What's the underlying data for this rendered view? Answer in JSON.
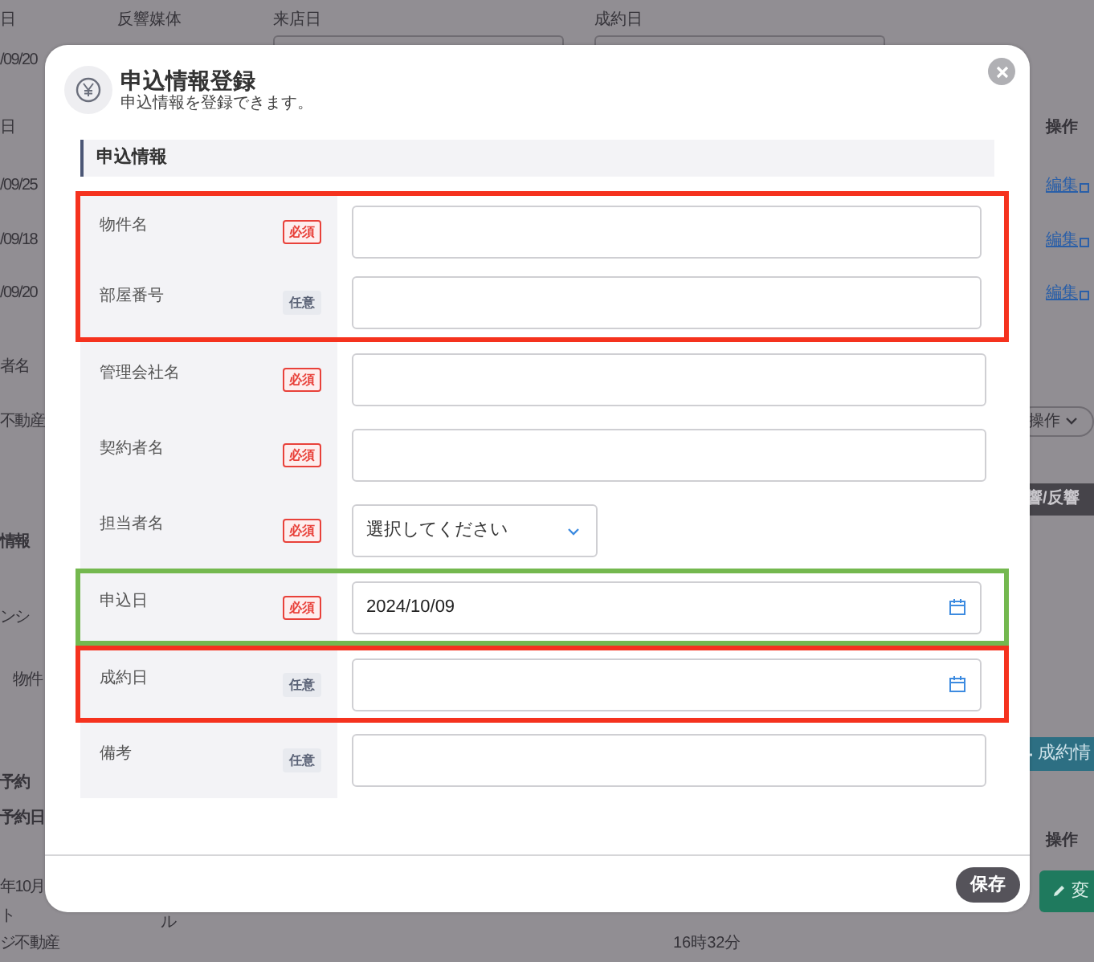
{
  "background": {
    "top_labels": [
      {
        "text": "日",
        "kind": "label"
      },
      {
        "text": "反響媒体",
        "kind": "label"
      },
      {
        "text": "来店日",
        "kind": "field-label"
      },
      {
        "text": "成約日",
        "kind": "field-label"
      }
    ],
    "left_column": [
      {
        "text": "/09/20",
        "kind": "text"
      },
      {
        "text": "日",
        "kind": "text"
      },
      {
        "text": "/09/25",
        "kind": "text"
      },
      {
        "text": "/09/18",
        "kind": "text"
      },
      {
        "text": "/09/20",
        "kind": "text"
      },
      {
        "text": "者名",
        "kind": "text"
      },
      {
        "text": "不動産",
        "kind": "text"
      },
      {
        "text": "情報",
        "kind": "heading"
      },
      {
        "text": "ンシ",
        "kind": "text"
      },
      {
        "text": "物件",
        "kind": "text"
      },
      {
        "text": "予約",
        "kind": "heading"
      },
      {
        "text": "予約日",
        "kind": "heading"
      },
      {
        "text": "年10月",
        "kind": "text"
      },
      {
        "text": "ト",
        "kind": "text"
      },
      {
        "text": "ジ不動産",
        "kind": "text"
      }
    ],
    "right_column": [
      {
        "text": "操作",
        "kind": "header"
      },
      {
        "text": "編集",
        "kind": "link"
      },
      {
        "text": "編集",
        "kind": "link"
      },
      {
        "text": "編集",
        "kind": "link"
      },
      {
        "text": "操作",
        "kind": "dropdown"
      },
      {
        "text": "響/反響",
        "kind": "dark-bar"
      },
      {
        "text": "成約情",
        "kind": "teal-button"
      },
      {
        "text": "操作",
        "kind": "header"
      },
      {
        "text": "変",
        "kind": "green-button"
      }
    ],
    "bottom_texts": [
      "ル",
      "16時32分"
    ]
  },
  "modal": {
    "title": "申込情報登録",
    "subtitle": "申込情報を登録できます。",
    "section": "申込情報",
    "fields": [
      {
        "label": "物件名",
        "badge": "必須",
        "required": true,
        "kind": "text",
        "color": "#f5321e"
      },
      {
        "label": "部屋番号",
        "badge": "任意",
        "required": false,
        "kind": "text",
        "color": "#f5321e"
      },
      {
        "label": "管理会社名",
        "badge": "必須",
        "required": true,
        "kind": "text"
      },
      {
        "label": "契約者名",
        "badge": "必須",
        "required": true,
        "kind": "text"
      },
      {
        "label": "担当者名",
        "badge": "必須",
        "required": true,
        "kind": "select",
        "value": "選択してください"
      },
      {
        "label": "申込日",
        "badge": "必須",
        "required": true,
        "kind": "date",
        "value": "2024/10/09",
        "color": "#74b84f"
      },
      {
        "label": "成約日",
        "badge": "任意",
        "required": false,
        "kind": "date",
        "color": "#f5321e"
      },
      {
        "label": "備考",
        "badge": "任意",
        "required": false,
        "kind": "text"
      }
    ],
    "save_button": "保存"
  }
}
